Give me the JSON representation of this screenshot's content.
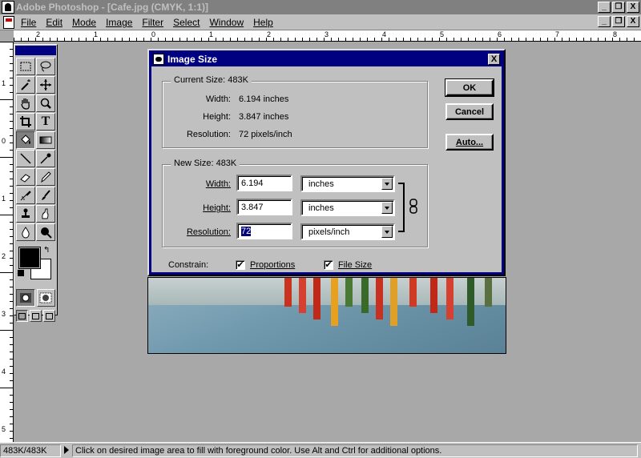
{
  "app": {
    "title": "Adobe Photoshop - [Cafe.jpg  (CMYK, 1:1)]",
    "window_buttons": [
      "_",
      "❐",
      "X"
    ],
    "doc_window_buttons": [
      "_",
      "❐",
      "X"
    ]
  },
  "menu": [
    "File",
    "Edit",
    "Mode",
    "Image",
    "Filter",
    "Select",
    "Window",
    "Help"
  ],
  "rulers": {
    "top_labels": [
      "2",
      "1",
      "0",
      "1",
      "2",
      "3",
      "4",
      "5",
      "6",
      "7",
      "8"
    ],
    "left_labels": [
      "1",
      "0",
      "1",
      "2",
      "3",
      "4",
      "5"
    ]
  },
  "toolbox": {
    "tools": [
      "marquee-icon",
      "lasso-icon",
      "magic-wand-icon",
      "move-icon",
      "hand-icon",
      "zoom-icon",
      "crop-icon",
      "type-icon",
      "paint-bucket-icon",
      "gradient-icon",
      "line-icon",
      "eyedropper-icon",
      "eraser-icon",
      "pencil-icon",
      "airbrush-icon",
      "paintbrush-icon",
      "rubber-stamp-icon",
      "smudge-icon",
      "blur-icon",
      "dodge-icon"
    ],
    "active_tool": "paint-bucket-icon",
    "type_glyph": "T"
  },
  "dialog": {
    "title": "Image Size",
    "close_label": "X",
    "current_size": {
      "label": "Current Size:  483K",
      "width_label": "Width:",
      "width_value": "6.194 inches",
      "height_label": "Height:",
      "height_value": "3.847 inches",
      "resolution_label": "Resolution:",
      "resolution_value": "72 pixels/inch"
    },
    "new_size": {
      "label": "New Size:  483K",
      "width_label": "Width:",
      "width_value": "6.194",
      "width_unit": "inches",
      "height_label": "Height:",
      "height_value": "3.847",
      "height_unit": "inches",
      "resolution_label": "Resolution:",
      "resolution_value": "72",
      "resolution_unit": "pixels/inch"
    },
    "constrain": {
      "label": "Constrain:",
      "proportions_label": "Proportions",
      "proportions_checked": true,
      "file_size_label": "File Size",
      "file_size_checked": true,
      "check_glyph": "✔"
    },
    "buttons": {
      "ok": "OK",
      "cancel": "Cancel",
      "auto": "Auto..."
    }
  },
  "status": {
    "doc_size": "483K/483K",
    "message": "Click on desired image area to fill with foreground color.  Use Alt and Ctrl for additional options."
  },
  "colors": {
    "title_active": "#000080",
    "chrome": "#c0c0c0",
    "workspace": "#a8a8a8"
  }
}
